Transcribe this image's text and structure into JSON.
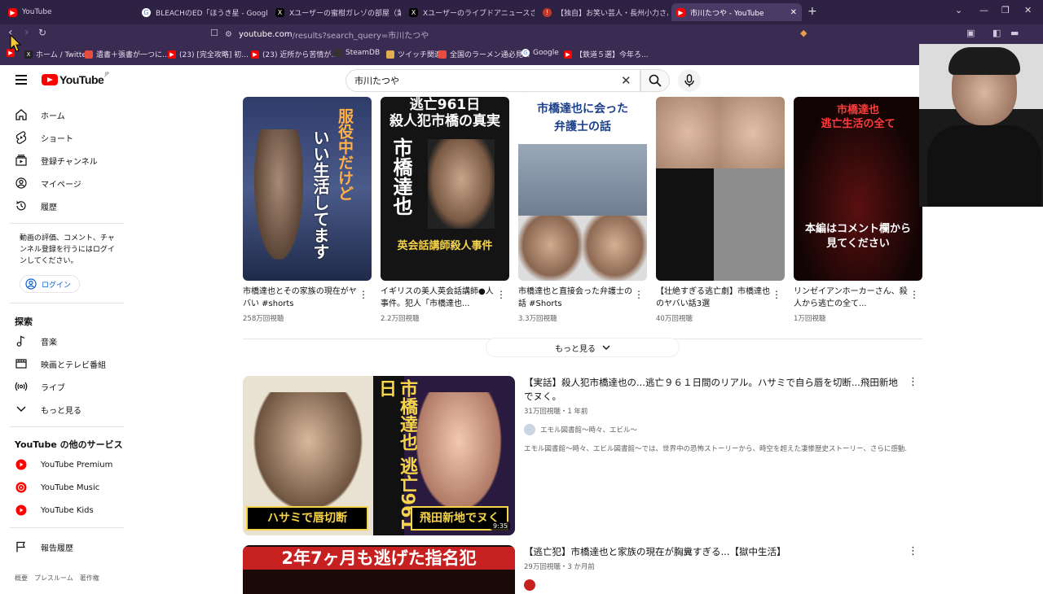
{
  "browser": {
    "tabs": [
      {
        "label": "YouTube",
        "icon": "youtube-icon",
        "active": false
      },
      {
        "label": "BLEACHのED「ほうき星 - Google 検索",
        "icon": "google-icon",
        "active": false
      },
      {
        "label": "Xユーザーの蜜柑ガレゾの部屋（業業投",
        "icon": "x-icon",
        "active": false
      },
      {
        "label": "Xユーザーのライブドアニュースさん「容疑",
        "icon": "x-icon",
        "active": false
      },
      {
        "label": "【独自】お笑い芸人・長州小力さんを遠",
        "icon": "news-icon",
        "active": false
      },
      {
        "label": "市川たつや - YouTube",
        "icon": "youtube-icon",
        "active": true
      }
    ],
    "url_host": "youtube.com",
    "url_path": "/results?search_query=市川たつや",
    "bookmarks": [
      {
        "label": "ホーム / Twitter",
        "icon": "x-icon",
        "color": "#222222"
      },
      {
        "label": "遺書＋張書が一つに...",
        "icon": "bookmark-icon",
        "color": "#e74c3c"
      },
      {
        "label": "(23) [完全攻略] 初...",
        "icon": "youtube-icon",
        "color": "#ff0000"
      },
      {
        "label": "(23) 近所から苦情が...",
        "icon": "youtube-icon",
        "color": "#ff0000"
      },
      {
        "label": "SteamDB",
        "icon": "steamdb-icon",
        "color": "#333333"
      },
      {
        "label": "ツイッチ関連",
        "icon": "folder-icon",
        "color": "#e0b050"
      },
      {
        "label": "全国のラーメン通必見...",
        "icon": "bookmark-icon",
        "color": "#e74c3c"
      },
      {
        "label": "Google",
        "icon": "google-icon",
        "color": "#4285f4"
      },
      {
        "label": "【鉄道５選】今年ろ...",
        "icon": "youtube-icon",
        "color": "#ff0000"
      }
    ]
  },
  "yt": {
    "logo_text": "YouTube",
    "logo_region": "JP",
    "search_value": "市川たつや"
  },
  "sidebar": {
    "items": [
      {
        "label": "ホーム",
        "icon": "home-icon"
      },
      {
        "label": "ショート",
        "icon": "shorts-icon"
      },
      {
        "label": "登録チャンネル",
        "icon": "subscriptions-icon"
      },
      {
        "label": "マイページ",
        "icon": "account-icon"
      },
      {
        "label": "履歴",
        "icon": "history-icon"
      }
    ],
    "signin_text": "動画の評価、コメント、チャンネル登録を行うにはログインしてください。",
    "signin_button": "ログイン",
    "explore_heading": "探索",
    "explore": [
      {
        "label": "音楽",
        "icon": "music-icon"
      },
      {
        "label": "映画とテレビ番組",
        "icon": "movies-icon"
      },
      {
        "label": "ライブ",
        "icon": "live-icon"
      },
      {
        "label": "もっと見る",
        "icon": "chevron-down-icon"
      }
    ],
    "more_heading": "YouTube の他のサービス",
    "services": [
      {
        "label": "YouTube Premium",
        "icon": "yt-premium-icon"
      },
      {
        "label": "YouTube Music",
        "icon": "yt-music-icon"
      },
      {
        "label": "YouTube Kids",
        "icon": "yt-kids-icon"
      }
    ],
    "report": {
      "label": "報告履歴",
      "icon": "flag-icon"
    },
    "footer": "概要　プレスルーム　著作権"
  },
  "shorts": [
    {
      "title": "市橋達也とその家族の現在がヤバい #shorts",
      "views": "258万回視聴",
      "overlay": "服役中だけど\nいい生活してます",
      "bg": "#3a4a78"
    },
    {
      "title": "イギリスの美人英会話講師●人事件。犯人「市橋達也...",
      "views": "2.2万回視聴",
      "overlay": "逃亡961日\n殺人犯市橋の真実\n市橋達也\n英会話講師殺人事件",
      "bg": "#1a1a1a"
    },
    {
      "title": "市橋達也と直接会った弁護士の話 #Shorts",
      "views": "3.3万回視聴",
      "overlay": "市橋達也に会った\n弁護士の話",
      "bg": "#5a6b80"
    },
    {
      "title": "【壮絶すぎる逃亡劇】市橋達也のヤバい話3選",
      "views": "40万回視聴",
      "overlay": "",
      "bg": "#c8a898"
    },
    {
      "title": "リンゼイアンホーカーさん、殺人から逃亡の全て...",
      "views": "1万回視聴",
      "overlay": "市橋達也\n逃亡生活の全て\n本編はコメント欄から\n見てください",
      "bg": "#1a0a0a"
    }
  ],
  "more_label": "もっと見る",
  "videos": [
    {
      "title": "【実話】殺人犯市橋達也の...逃亡９６１日間のリアル。ハサミで自ら唇を切断...飛田新地でヌく。",
      "meta": "31万回視聴・1 年前",
      "channel": "エモル図書館〜時々、エビル〜",
      "desc": "エモル図書館〜時々、エビル図書館〜では、世界中の恐怖ストーリーから、時空を超えた凄惨歴史ストーリー、さらに感動...",
      "duration": "9:35",
      "overlay_left": "ハサミで唇切断",
      "overlay_right": "飛田新地でヌく",
      "overlay_vert": "市橋達也 逃亡961日"
    },
    {
      "title": "【逃亡犯】市橋達也と家族の現在が胸糞すぎる...【獄中生活】",
      "meta": "29万回視聴・3 か月前",
      "channel": "",
      "desc": "",
      "duration": "",
      "overlay_left": "2年7ヶ月も逃げた指名犯",
      "overlay_right": "",
      "overlay_vert": ""
    }
  ],
  "colors": {
    "brand_red": "#ff0000",
    "browser_bg": "#3a2b52",
    "link_blue": "#065fd4"
  }
}
